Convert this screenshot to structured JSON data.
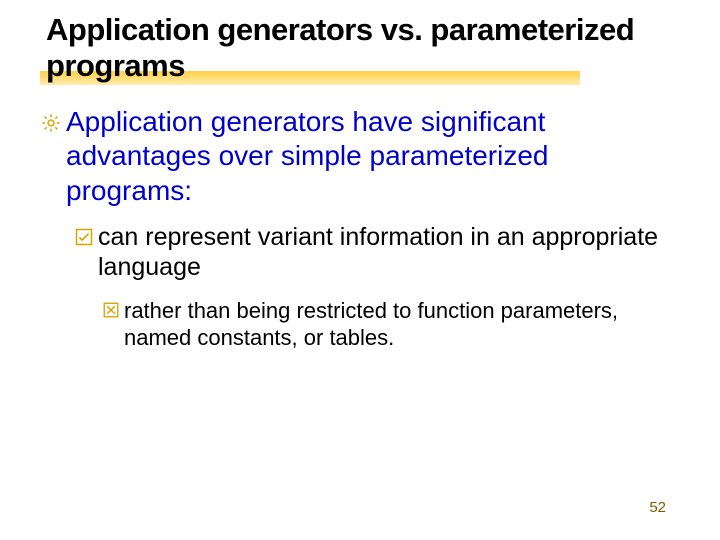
{
  "title": "Application generators vs. parameterized programs",
  "bullets": {
    "lvl1": "Application generators have significant advantages over simple parameterized programs:",
    "lvl2": "can represent variant information in an appropriate language",
    "lvl3": "rather than being restricted to function parameters, named constants, or tables."
  },
  "page_number": "52",
  "colors": {
    "accent_orange": "#d9a300",
    "title_highlight": "#ffcc33",
    "body_blue": "#0000cc"
  }
}
